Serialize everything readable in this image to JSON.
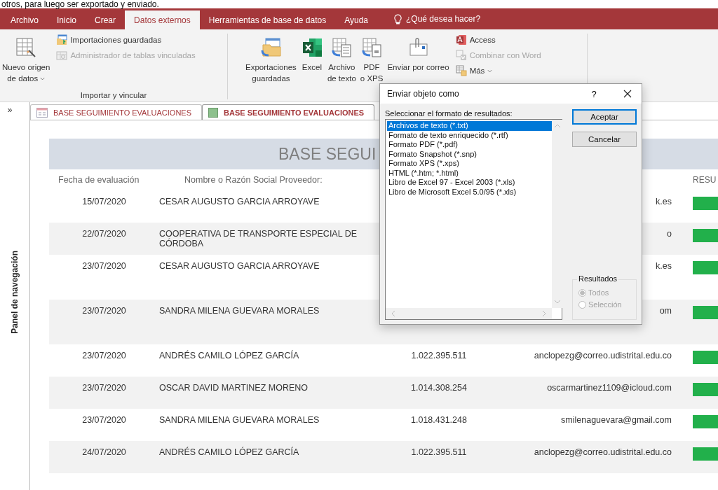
{
  "document_text": "otros, para luego ser exportado y enviado.",
  "ribbon": {
    "tabs": [
      {
        "label": "Archivo",
        "selected": false
      },
      {
        "label": "Inicio",
        "selected": false
      },
      {
        "label": "Crear",
        "selected": false
      },
      {
        "label": "Datos externos",
        "selected": true
      },
      {
        "label": "Herramientas de base de datos",
        "selected": false
      },
      {
        "label": "Ayuda",
        "selected": false
      }
    ],
    "tell_me": "¿Qué desea hacer?",
    "groups": [
      {
        "label": "Importar y vincular",
        "large": [
          {
            "kind": "table",
            "lines": [
              "Nuevo origen",
              "de datos"
            ],
            "dropdown": true
          }
        ],
        "small": [
          {
            "kind": "saved-import",
            "label": "Importaciones guardadas",
            "disabled": false,
            "dropdown": false
          },
          {
            "kind": "linked-table",
            "label": "Administrador de tablas vinculadas",
            "disabled": true,
            "dropdown": false
          }
        ]
      },
      {
        "large": [
          {
            "kind": "saved-export",
            "lines": [
              "Exportaciones",
              "guardadas"
            ],
            "dropdown": false
          },
          {
            "kind": "excel",
            "lines": [
              "Excel"
            ],
            "dropdown": false
          },
          {
            "kind": "text-file",
            "lines": [
              "Archivo",
              "de texto"
            ],
            "dropdown": false
          },
          {
            "kind": "pdf",
            "lines": [
              "PDF",
              "o XPS"
            ],
            "dropdown": false
          },
          {
            "kind": "email",
            "lines": [
              "Enviar por correo"
            ],
            "dropdown": false
          }
        ],
        "small": [
          {
            "kind": "access",
            "label": "Access",
            "disabled": false,
            "dropdown": false
          },
          {
            "kind": "word-merge",
            "label": "Combinar con Word",
            "disabled": true,
            "dropdown": false
          },
          {
            "kind": "more",
            "label": "Más",
            "disabled": false,
            "dropdown": true
          }
        ]
      }
    ]
  },
  "nav_pane": {
    "expand": "»",
    "label": "Panel de navegación"
  },
  "doc_tabs": [
    {
      "kind": "form",
      "label": "BASE SEGUIMIENTO EVALUACIONES",
      "selected": false
    },
    {
      "kind": "report",
      "label": "BASE SEGUIMIENTO EVALUACIONES",
      "selected": true
    }
  ],
  "report": {
    "title": "BASE SEGUI",
    "headers": {
      "date": "Fecha de evaluación",
      "name": "Nombre o Razón Social Proveedor:",
      "result": "RESU"
    },
    "rows": [
      {
        "date": "15/07/2020",
        "name": "CESAR AUGUSTO GARCIA ARROYAVE",
        "email": "k.es"
      },
      {
        "date": "22/07/2020",
        "name": "COOPERATIVA DE TRANSPORTE ESPECIAL DE CÓRDOBA",
        "email": "o"
      },
      {
        "date": "23/07/2020",
        "name": "CESAR AUGUSTO GARCIA ARROYAVE",
        "email": "k.es"
      },
      {
        "date": "23/07/2020",
        "name": "SANDRA MILENA GUEVARA MORALES",
        "email": "om"
      },
      {
        "date": "23/07/2020",
        "name": "ANDRÉS CAMILO LÓPEZ GARCÍA",
        "id": "1.022.395.511",
        "email": "anclopezg@correo.udistrital.edu.co"
      },
      {
        "date": "23/07/2020",
        "name": "OSCAR DAVID MARTINEZ MORENO",
        "id": "1.014.308.254",
        "email": "oscarmartinez1109@icloud.com"
      },
      {
        "date": "23/07/2020",
        "name": "SANDRA MILENA GUEVARA MORALES",
        "id": "1.018.431.248",
        "email": "smilenaguevara@gmail.com"
      },
      {
        "date": "24/07/2020",
        "name": "ANDRÉS CAMILO LÓPEZ GARCÍA",
        "id": "1.022.395.511",
        "email": "anclopezg@correo.udistrital.edu.co"
      }
    ]
  },
  "dialog": {
    "title": "Enviar objeto como",
    "help": "?",
    "list_label": "Seleccionar el formato de resultados:",
    "formats": [
      {
        "label": "Archivos de texto (*.txt)",
        "selected": true
      },
      {
        "label": "Formato de texto enriquecido (*.rtf)",
        "selected": false
      },
      {
        "label": "Formato PDF (*.pdf)",
        "selected": false
      },
      {
        "label": "Formato Snapshot (*.snp)",
        "selected": false
      },
      {
        "label": "Formato XPS (*.xps)",
        "selected": false
      },
      {
        "label": "HTML (*.htm; *.html)",
        "selected": false
      },
      {
        "label": "Libro de Excel 97 - Excel 2003 (*.xls)",
        "selected": false
      },
      {
        "label": "Libro de Microsoft Excel 5.0/95 (*.xls)",
        "selected": false
      }
    ],
    "buttons": [
      {
        "label": "Aceptar",
        "default": true
      },
      {
        "label": "Cancelar",
        "default": false
      }
    ],
    "results": {
      "label": "Resultados",
      "options": [
        {
          "label": "Todos",
          "selected": true,
          "disabled": true
        },
        {
          "label": "Selección",
          "selected": false,
          "disabled": true
        }
      ]
    }
  }
}
